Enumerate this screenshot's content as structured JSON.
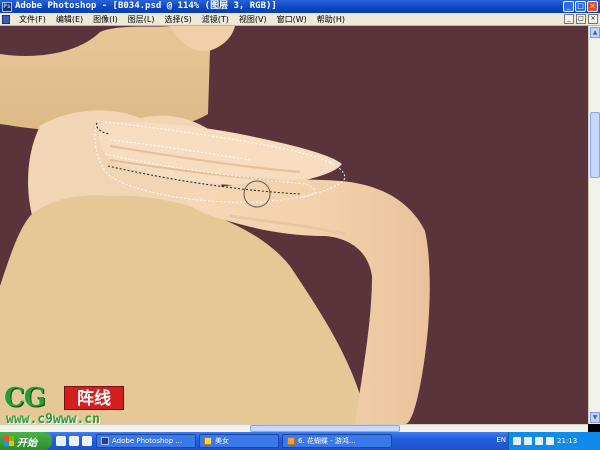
{
  "window": {
    "title": "Adobe Photoshop - [B034.psd @ 114% (图层 3, RGB)]",
    "app_icon_label": "Ps",
    "minimize_label": "_",
    "maximize_label": "□",
    "close_label": "×"
  },
  "menu": {
    "items": [
      {
        "label": "文件(F)"
      },
      {
        "label": "编辑(E)"
      },
      {
        "label": "图像(I)"
      },
      {
        "label": "图层(L)"
      },
      {
        "label": "选择(S)"
      },
      {
        "label": "滤镜(T)"
      },
      {
        "label": "视图(V)"
      },
      {
        "label": "窗口(W)"
      },
      {
        "label": "帮助(H)"
      }
    ],
    "doc_minimize": "_",
    "doc_restore": "□",
    "doc_close": "×"
  },
  "colors": {
    "canvas_bg": "#5b333b",
    "skin": "#f3d2ae",
    "garment": "#e7c895",
    "selection": "#ffffff"
  },
  "watermark": {
    "cg": "CG",
    "zh": "阵线",
    "url": "www.c9www.cn"
  },
  "taskbar": {
    "start_label": "开始",
    "tasks": [
      {
        "label": "Adobe Photoshop ...",
        "icon": "photoshop-icon"
      },
      {
        "label": "美女",
        "icon": "folder-icon"
      },
      {
        "label": "6. 花蝴蝶 - 游鸿...",
        "icon": "media-player-icon"
      }
    ],
    "language": "EN",
    "clock": "21:13"
  }
}
